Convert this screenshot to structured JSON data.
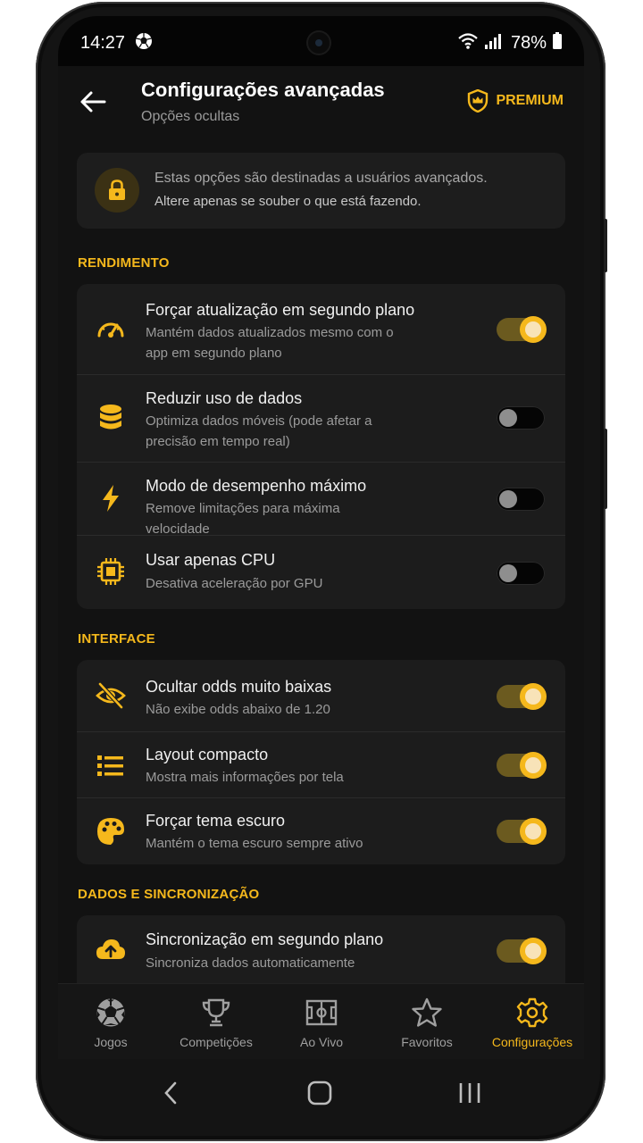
{
  "status": {
    "time": "14:27",
    "battery": "78%"
  },
  "header": {
    "title": "Configurações avançadas",
    "subtitle": "Opções ocultas",
    "premium_label": "PREMIUM"
  },
  "notice": {
    "line1": "Estas opções são destinadas a usuários avançados.",
    "line2": "Altere apenas se souber o que está fazendo."
  },
  "sections": {
    "performance": {
      "title": "RENDIMENTO",
      "items": [
        {
          "title": "Forçar atualização em segundo plano",
          "subtitle": "Mantém dados atualizados mesmo com o app em segundo plano",
          "enabled": true
        },
        {
          "title": "Reduzir uso de dados",
          "subtitle": "Optimiza dados móveis (pode afetar a precisão em tempo real)",
          "enabled": false
        },
        {
          "title": "Modo de desempenho máximo",
          "subtitle": "Remove limitações para máxima velocidade",
          "enabled": false
        },
        {
          "title": "Usar apenas CPU",
          "subtitle": "Desativa aceleração por GPU",
          "enabled": false
        }
      ]
    },
    "interface": {
      "title": "INTERFACE",
      "items": [
        {
          "title": "Ocultar odds muito baixas",
          "subtitle": "Não exibe odds abaixo de 1.20",
          "enabled": true
        },
        {
          "title": "Layout compacto",
          "subtitle": "Mostra mais informações por tela",
          "enabled": true
        },
        {
          "title": "Forçar tema escuro",
          "subtitle": "Mantém o tema escuro sempre ativo",
          "enabled": true
        }
      ]
    },
    "sync": {
      "title": "DADOS E SINCRONIZAÇÃO",
      "items": [
        {
          "title": "Sincronização em segundo plano",
          "subtitle": "Sincroniza dados automaticamente",
          "enabled": true
        }
      ]
    }
  },
  "bottom_nav": [
    {
      "label": "Jogos",
      "icon": "soccer-ball-icon",
      "active": false
    },
    {
      "label": "Competições",
      "icon": "trophy-icon",
      "active": false
    },
    {
      "label": "Ao Vivo",
      "icon": "field-icon",
      "active": false
    },
    {
      "label": "Favoritos",
      "icon": "star-icon",
      "active": false
    },
    {
      "label": "Configurações",
      "icon": "gear-icon",
      "active": true
    }
  ],
  "colors": {
    "accent": "#f5b81c",
    "background": "#121212",
    "card": "#1c1c1c"
  }
}
